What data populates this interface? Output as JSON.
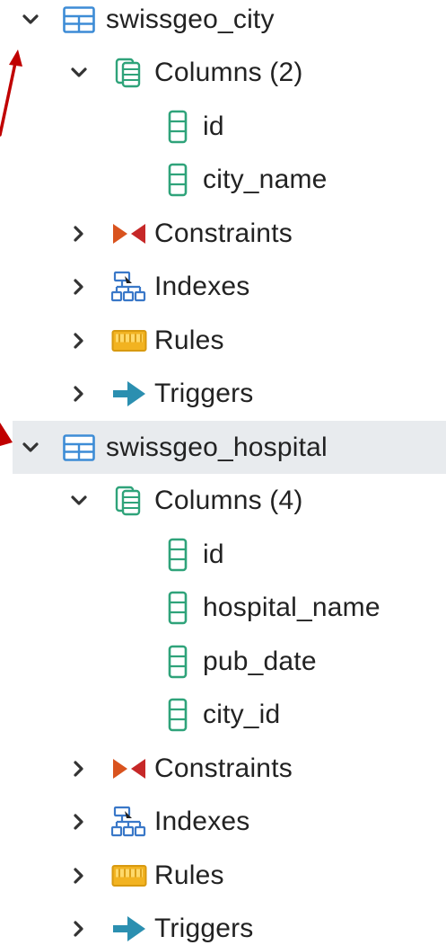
{
  "tree": {
    "tables": [
      {
        "name": "swissgeo_city",
        "expanded": true,
        "columns_label": "Columns (2)",
        "columns": [
          "id",
          "city_name"
        ],
        "constraints_label": "Constraints",
        "indexes_label": "Indexes",
        "rules_label": "Rules",
        "triggers_label": "Triggers"
      },
      {
        "name": "swissgeo_hospital",
        "expanded": true,
        "selected": true,
        "columns_label": "Columns (4)",
        "columns": [
          "id",
          "hospital_name",
          "pub_date",
          "city_id"
        ],
        "constraints_label": "Constraints",
        "indexes_label": "Indexes",
        "rules_label": "Rules",
        "triggers_label": "Triggers"
      }
    ]
  },
  "colors": {
    "selection_bg": "#e8ebee",
    "table_icon": "#3d8cd6",
    "column_icon": "#2fa37a",
    "constraint_left": "#d9531e",
    "constraint_right": "#c62828",
    "index_icon": "#3a78c8",
    "rules_icon": "#f2b321",
    "triggers_icon": "#2b8fb0",
    "annotation_arrow": "#c00000"
  }
}
